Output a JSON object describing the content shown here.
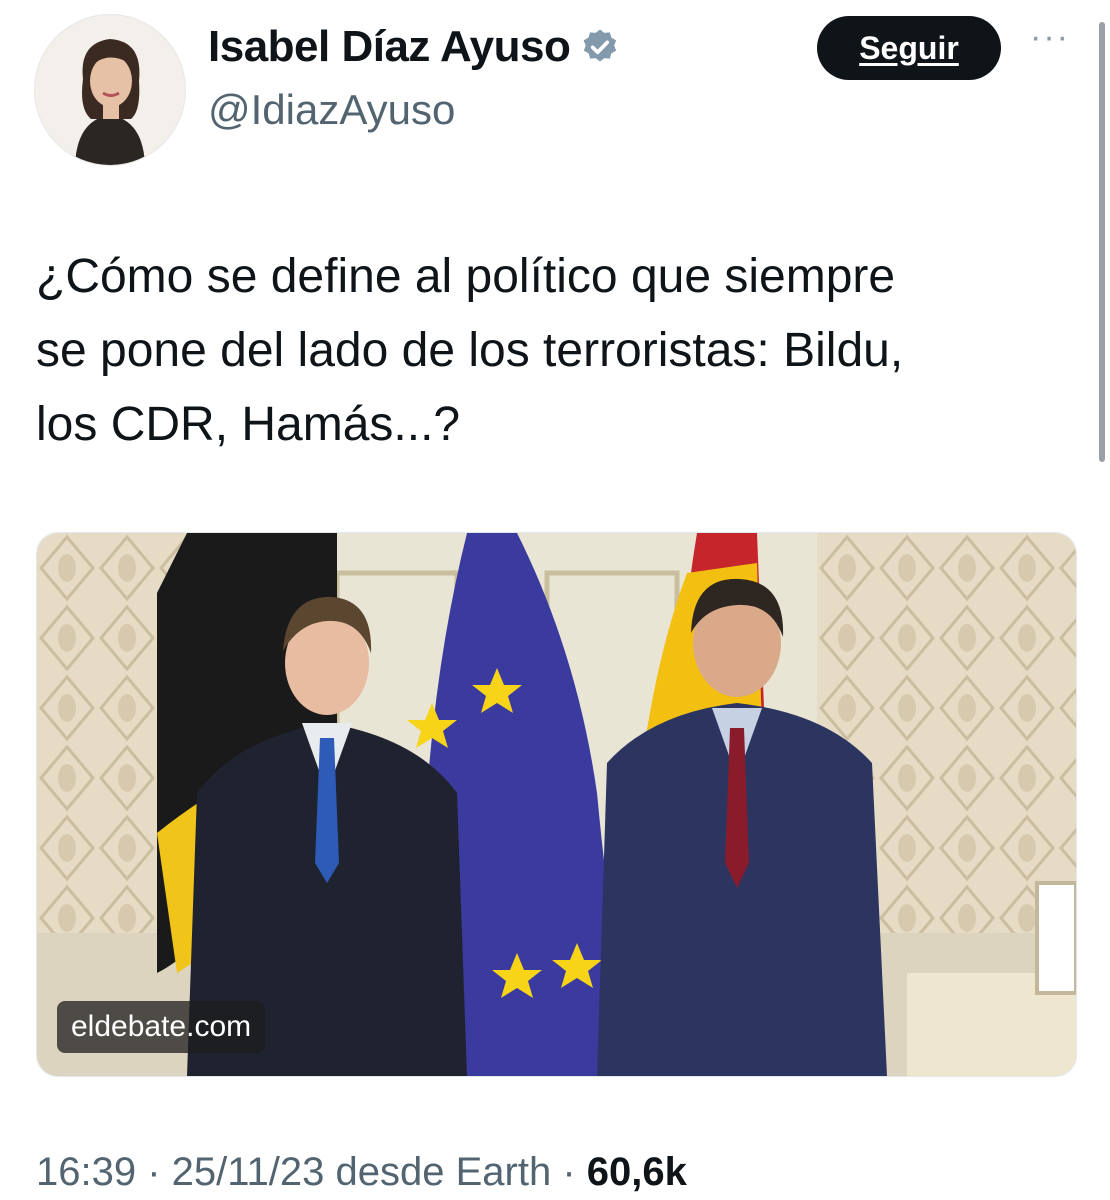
{
  "author": {
    "name": "Isabel Díaz Ayuso",
    "handle": "@IdiazAyuso",
    "verified_icon": "verified-badge",
    "verified_color": "#829aab"
  },
  "actions": {
    "follow_label": "Seguir",
    "more_label": "···"
  },
  "tweet": {
    "text": "¿Cómo se define al político que siempre\nse pone del lado de los terroristas: Bildu,\nlos CDR, Hamás...?"
  },
  "media": {
    "source_label": "eldebate.com"
  },
  "meta": {
    "time": "16:39",
    "sep1": " · ",
    "date": "25/11/23",
    "via": " desde Earth",
    "sep2": " · ",
    "views": "60,6k"
  }
}
